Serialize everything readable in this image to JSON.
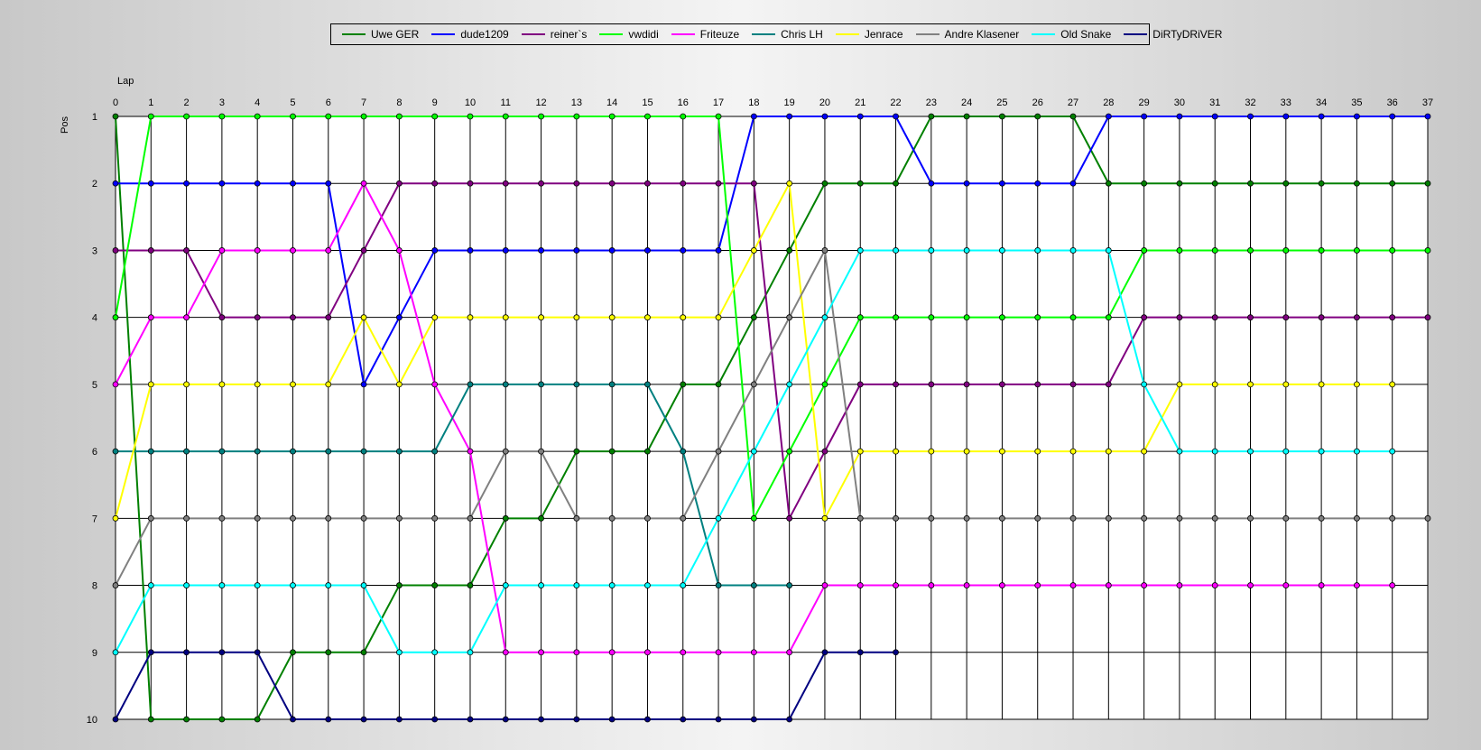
{
  "chart_data": {
    "type": "line",
    "xlabel": "Lap",
    "ylabel": "Pos",
    "xlim": [
      0,
      37
    ],
    "ylim": [
      1,
      10
    ],
    "y_inverted": true,
    "grid": true,
    "legend_position": "top-center",
    "x": [
      0,
      1,
      2,
      3,
      4,
      5,
      6,
      7,
      8,
      9,
      10,
      11,
      12,
      13,
      14,
      15,
      16,
      17,
      18,
      19,
      20,
      21,
      22,
      23,
      24,
      25,
      26,
      27,
      28,
      29,
      30,
      31,
      32,
      33,
      34,
      35,
      36,
      37
    ],
    "series": [
      {
        "name": "Uwe GER",
        "color": "#008000",
        "values": [
          1,
          10,
          10,
          10,
          10,
          9,
          9,
          9,
          8,
          8,
          8,
          7,
          7,
          6,
          6,
          6,
          5,
          5,
          4,
          3,
          2,
          2,
          2,
          1,
          1,
          1,
          1,
          1,
          2,
          2,
          2,
          2,
          2,
          2,
          2,
          2,
          2,
          2
        ]
      },
      {
        "name": "dude1209",
        "color": "#0000ff",
        "values": [
          2,
          2,
          2,
          2,
          2,
          2,
          2,
          5,
          4,
          3,
          3,
          3,
          3,
          3,
          3,
          3,
          3,
          3,
          1,
          1,
          1,
          1,
          1,
          2,
          2,
          2,
          2,
          2,
          1,
          1,
          1,
          1,
          1,
          1,
          1,
          1,
          1,
          1
        ]
      },
      {
        "name": "reiner`s",
        "color": "#800080",
        "values": [
          3,
          3,
          3,
          4,
          4,
          4,
          4,
          3,
          2,
          2,
          2,
          2,
          2,
          2,
          2,
          2,
          2,
          2,
          2,
          7,
          6,
          5,
          5,
          5,
          5,
          5,
          5,
          5,
          5,
          4,
          4,
          4,
          4,
          4,
          4,
          4,
          4,
          4
        ]
      },
      {
        "name": "vwdidi",
        "color": "#00ff00",
        "values": [
          4,
          1,
          1,
          1,
          1,
          1,
          1,
          1,
          1,
          1,
          1,
          1,
          1,
          1,
          1,
          1,
          1,
          1,
          7,
          6,
          5,
          4,
          4,
          4,
          4,
          4,
          4,
          4,
          4,
          3,
          3,
          3,
          3,
          3,
          3,
          3,
          3,
          3
        ]
      },
      {
        "name": "Friteuze",
        "color": "#ff00ff",
        "values": [
          5,
          4,
          4,
          3,
          3,
          3,
          3,
          2,
          3,
          5,
          6,
          9,
          9,
          9,
          9,
          9,
          9,
          9,
          9,
          9,
          8,
          8,
          8,
          8,
          8,
          8,
          8,
          8,
          8,
          8,
          8,
          8,
          8,
          8,
          8,
          8,
          8
        ]
      },
      {
        "name": "Chris LH",
        "color": "#008080",
        "values": [
          6,
          6,
          6,
          6,
          6,
          6,
          6,
          6,
          6,
          6,
          5,
          5,
          5,
          5,
          5,
          5,
          6,
          8,
          8,
          8
        ]
      },
      {
        "name": "Jenrace",
        "color": "#ffff00",
        "values": [
          7,
          5,
          5,
          5,
          5,
          5,
          5,
          4,
          5,
          4,
          4,
          4,
          4,
          4,
          4,
          4,
          4,
          4,
          3,
          2,
          7,
          6,
          6,
          6,
          6,
          6,
          6,
          6,
          6,
          6,
          5,
          5,
          5,
          5,
          5,
          5,
          5
        ]
      },
      {
        "name": "Andre Klasener",
        "color": "#808080",
        "values": [
          8,
          7,
          7,
          7,
          7,
          7,
          7,
          7,
          7,
          7,
          7,
          6,
          6,
          7,
          7,
          7,
          7,
          6,
          5,
          4,
          3,
          7,
          7,
          7,
          7,
          7,
          7,
          7,
          7,
          7,
          7,
          7,
          7,
          7,
          7,
          7,
          7,
          7
        ]
      },
      {
        "name": "Old Snake",
        "color": "#00ffff",
        "values": [
          9,
          8,
          8,
          8,
          8,
          8,
          8,
          8,
          9,
          9,
          9,
          8,
          8,
          8,
          8,
          8,
          8,
          7,
          6,
          5,
          4,
          3,
          3,
          3,
          3,
          3,
          3,
          3,
          3,
          5,
          6,
          6,
          6,
          6,
          6,
          6,
          6
        ]
      },
      {
        "name": "DiRTyDRiVER",
        "color": "#000080",
        "values": [
          10,
          9,
          9,
          9,
          9,
          10,
          10,
          10,
          10,
          10,
          10,
          10,
          10,
          10,
          10,
          10,
          10,
          10,
          10,
          10,
          9,
          9,
          9
        ]
      }
    ]
  }
}
